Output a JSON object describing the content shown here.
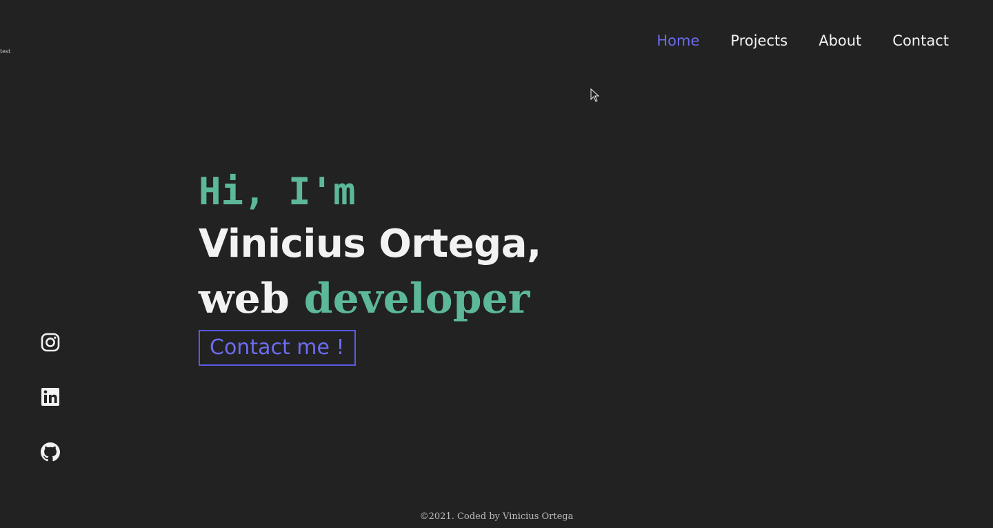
{
  "debug_text": "test",
  "nav": {
    "items": [
      {
        "label": "Home",
        "active": true
      },
      {
        "label": "Projects",
        "active": false
      },
      {
        "label": "About",
        "active": false
      },
      {
        "label": "Contact",
        "active": false
      }
    ]
  },
  "hero": {
    "greeting": "Hi, I'm",
    "name": "Vinicius Ortega,",
    "role_prefix": "web",
    "role_accent": "developer",
    "cta_label": "Contact me !"
  },
  "social": [
    {
      "icon": "instagram-icon"
    },
    {
      "icon": "linkedin-icon"
    },
    {
      "icon": "github-icon"
    }
  ],
  "footer": {
    "text": "©2021. Coded by Vinicius Ortega"
  },
  "colors": {
    "background": "#222222",
    "accent_green": "#5cb898",
    "accent_blue": "#6c6cf0",
    "text": "#f2f2f2"
  }
}
